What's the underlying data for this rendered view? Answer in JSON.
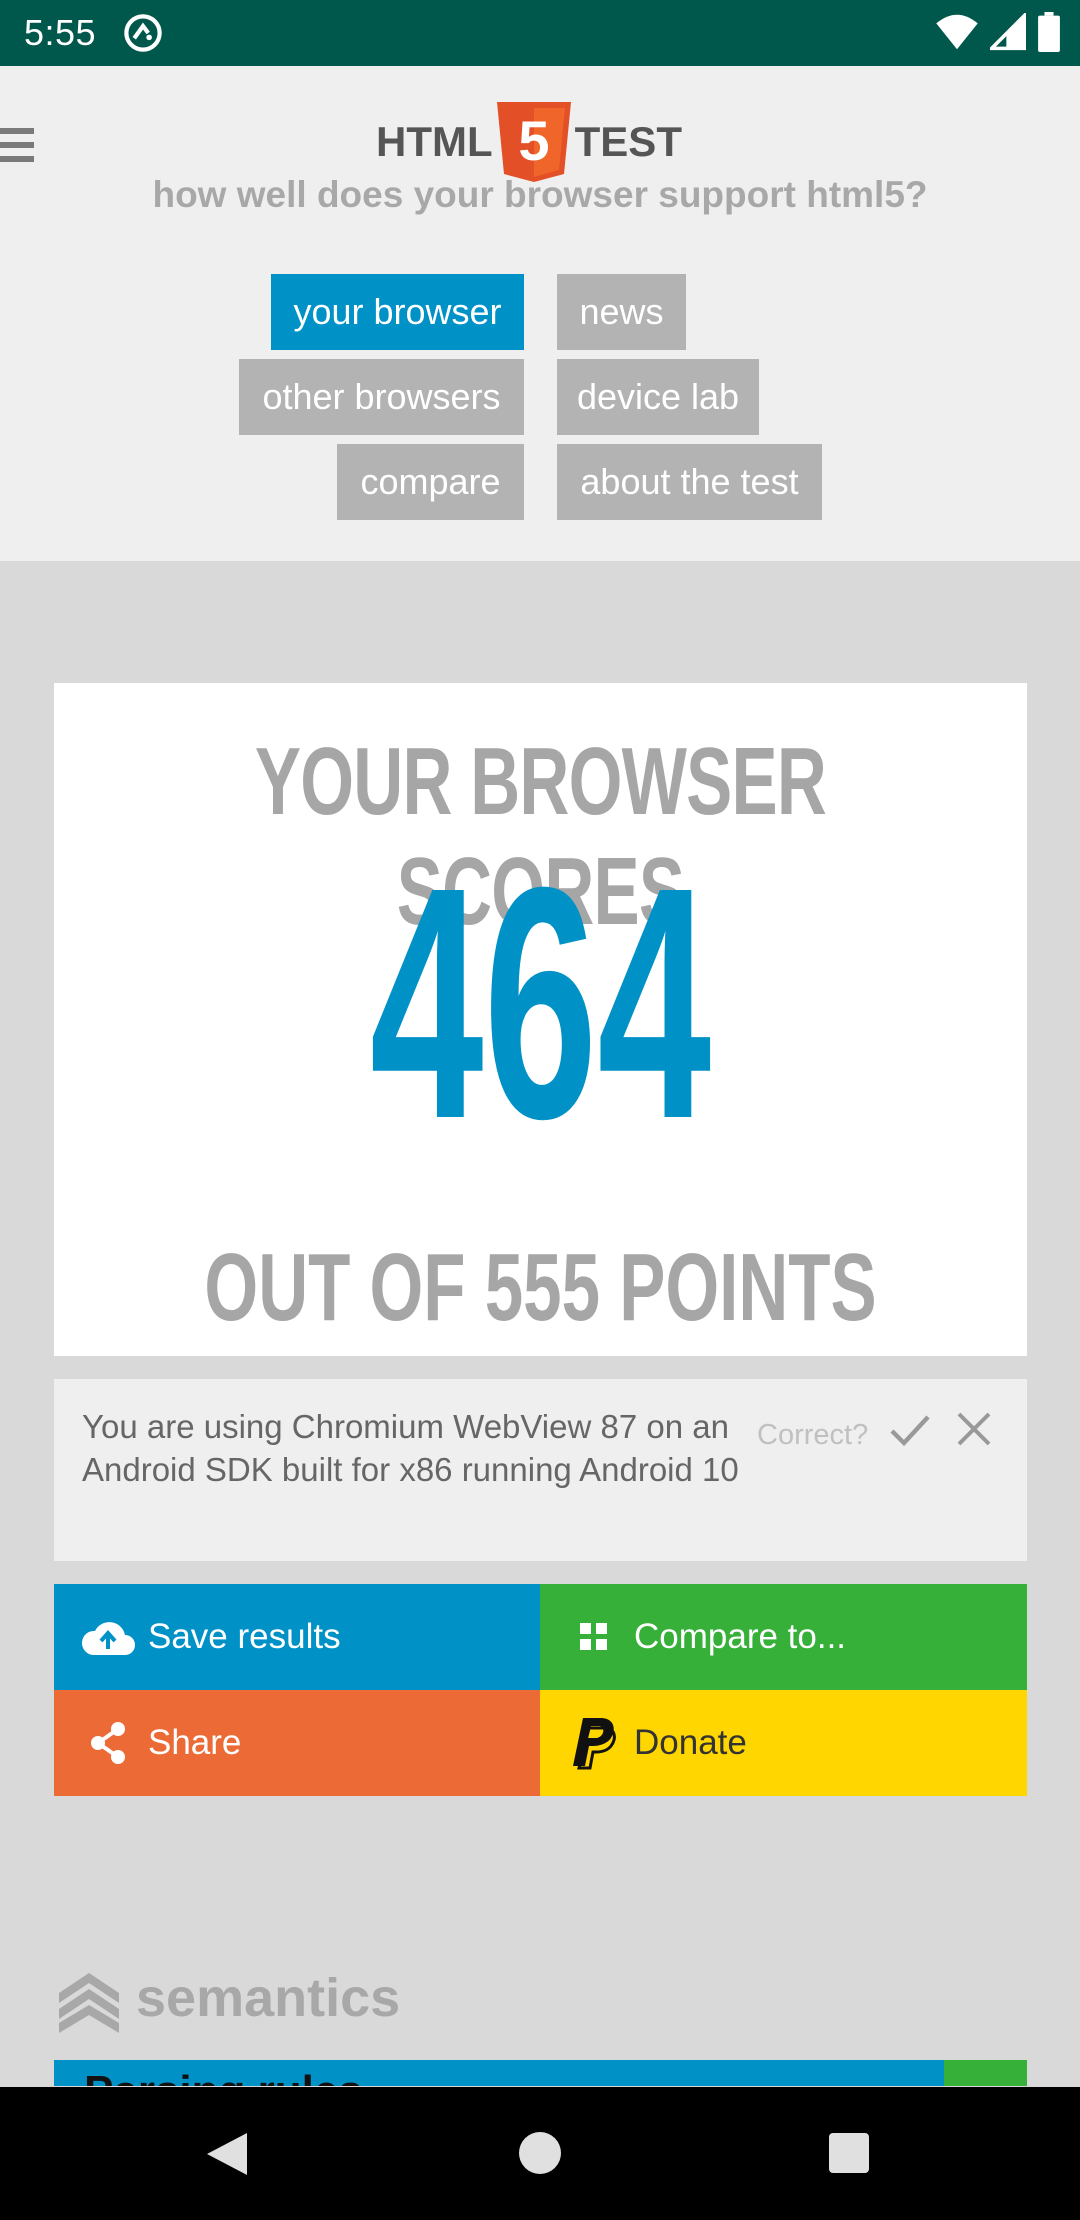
{
  "status_bar": {
    "time": "5:55",
    "icons": [
      "at-sign-icon",
      "wifi-icon",
      "signal-icon",
      "battery-icon"
    ]
  },
  "header": {
    "logo_left": "HTML",
    "logo_number": "5",
    "logo_right": "TEST",
    "tagline": "how well does your browser support html5?"
  },
  "nav": {
    "your_browser": "your browser",
    "news": "news",
    "other_browsers": "other browsers",
    "device_lab": "device lab",
    "compare": "compare",
    "about": "about the test"
  },
  "score": {
    "title": "YOUR BROWSER SCORES",
    "value": "464",
    "out_of": "OUT OF 555 POINTS"
  },
  "info": {
    "text": "You are using Chromium WebView 87 on an Android SDK built for x86 running Android 10",
    "correct_label": "Correct?"
  },
  "actions": {
    "save": "Save results",
    "compare": "Compare to...",
    "share": "Share",
    "donate": "Donate"
  },
  "section": {
    "title": "semantics",
    "partial_heading": "Parsing rules"
  },
  "colors": {
    "blue": "#0091c7",
    "green": "#37b03a",
    "orange": "#ec6a35",
    "yellow": "#ffd600",
    "status_bar": "#00574b",
    "logo_orange": "#e34f26"
  }
}
